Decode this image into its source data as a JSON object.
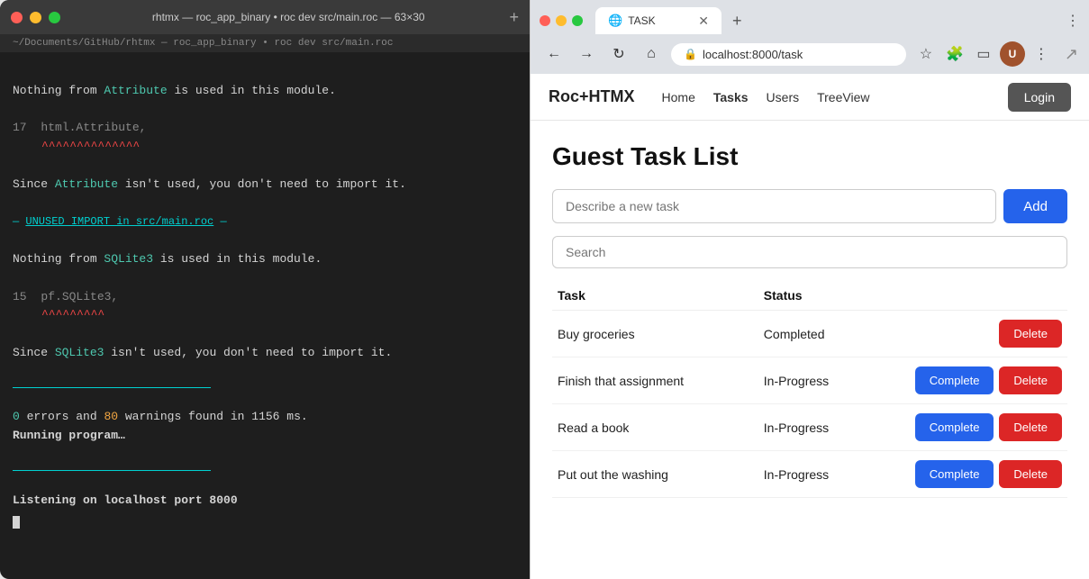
{
  "terminal": {
    "title": "rhtmx — roc_app_binary • roc dev src/main.roc — 63×30",
    "subtitle": "~/Documents/GitHub/rhtmx — roc_app_binary • roc dev src/main.roc",
    "lines": [
      {
        "type": "plain",
        "text": ""
      },
      {
        "type": "warn",
        "before": "Nothing from ",
        "keyword": "Attribute",
        "after": " is used in this module."
      },
      {
        "type": "plain",
        "text": ""
      },
      {
        "type": "code",
        "linenum": "17",
        "code": "    html.Attribute,",
        "underline": "    ^^^^^^^^^^^^^^"
      },
      {
        "type": "plain",
        "text": ""
      },
      {
        "type": "warn",
        "before": "Since ",
        "keyword": "Attribute",
        "after": " isn't used, you don't need to import it."
      },
      {
        "type": "plain",
        "text": ""
      },
      {
        "type": "separator",
        "text": "— UNUSED IMPORT in src/main.roc —"
      },
      {
        "type": "plain",
        "text": ""
      },
      {
        "type": "warn",
        "before": "Nothing from ",
        "keyword": "SQLite3",
        "after": " is used in this module."
      },
      {
        "type": "plain",
        "text": ""
      },
      {
        "type": "code",
        "linenum": "15",
        "code": "    pf.SQLite3,",
        "underline": "    ^^^^^^^^^"
      },
      {
        "type": "plain",
        "text": ""
      },
      {
        "type": "warn",
        "before": "Since ",
        "keyword": "SQLite3",
        "after": " isn't used, you don't need to import it."
      },
      {
        "type": "plain",
        "text": ""
      },
      {
        "type": "plain",
        "text": ""
      },
      {
        "type": "plain",
        "text": ""
      },
      {
        "type": "counts",
        "errors": "0",
        "warnings": "80",
        "suffix": " warnings found in 1156 ms."
      },
      {
        "type": "running",
        "text": "Running program…"
      },
      {
        "type": "plain",
        "text": ""
      },
      {
        "type": "plain",
        "text": ""
      },
      {
        "type": "listening",
        "text": "Listening on localhost port 8000"
      },
      {
        "type": "cursor"
      }
    ]
  },
  "browser": {
    "tab_label": "TASK",
    "tab_icon": "🌐",
    "url": "localhost:8000/task",
    "new_tab_label": "+",
    "menu_label": "⋮"
  },
  "app": {
    "brand": "Roc+HTMX",
    "nav": {
      "home": "Home",
      "tasks": "Tasks",
      "users": "Users",
      "treeview": "TreeView",
      "login": "Login"
    },
    "page_title": "Guest Task List",
    "task_input_placeholder": "Describe a new task",
    "add_button": "Add",
    "search_placeholder": "Search",
    "table": {
      "col_task": "Task",
      "col_status": "Status",
      "rows": [
        {
          "task": "Buy groceries",
          "status": "Completed",
          "show_complete": false,
          "show_delete": true
        },
        {
          "task": "Finish that assignment",
          "status": "In-Progress",
          "show_complete": true,
          "show_delete": true
        },
        {
          "task": "Read a book",
          "status": "In-Progress",
          "show_complete": true,
          "show_delete": true
        },
        {
          "task": "Put out the washing",
          "status": "In-Progress",
          "show_complete": true,
          "show_delete": true
        }
      ]
    },
    "complete_label": "Complete",
    "delete_label": "Delete"
  }
}
